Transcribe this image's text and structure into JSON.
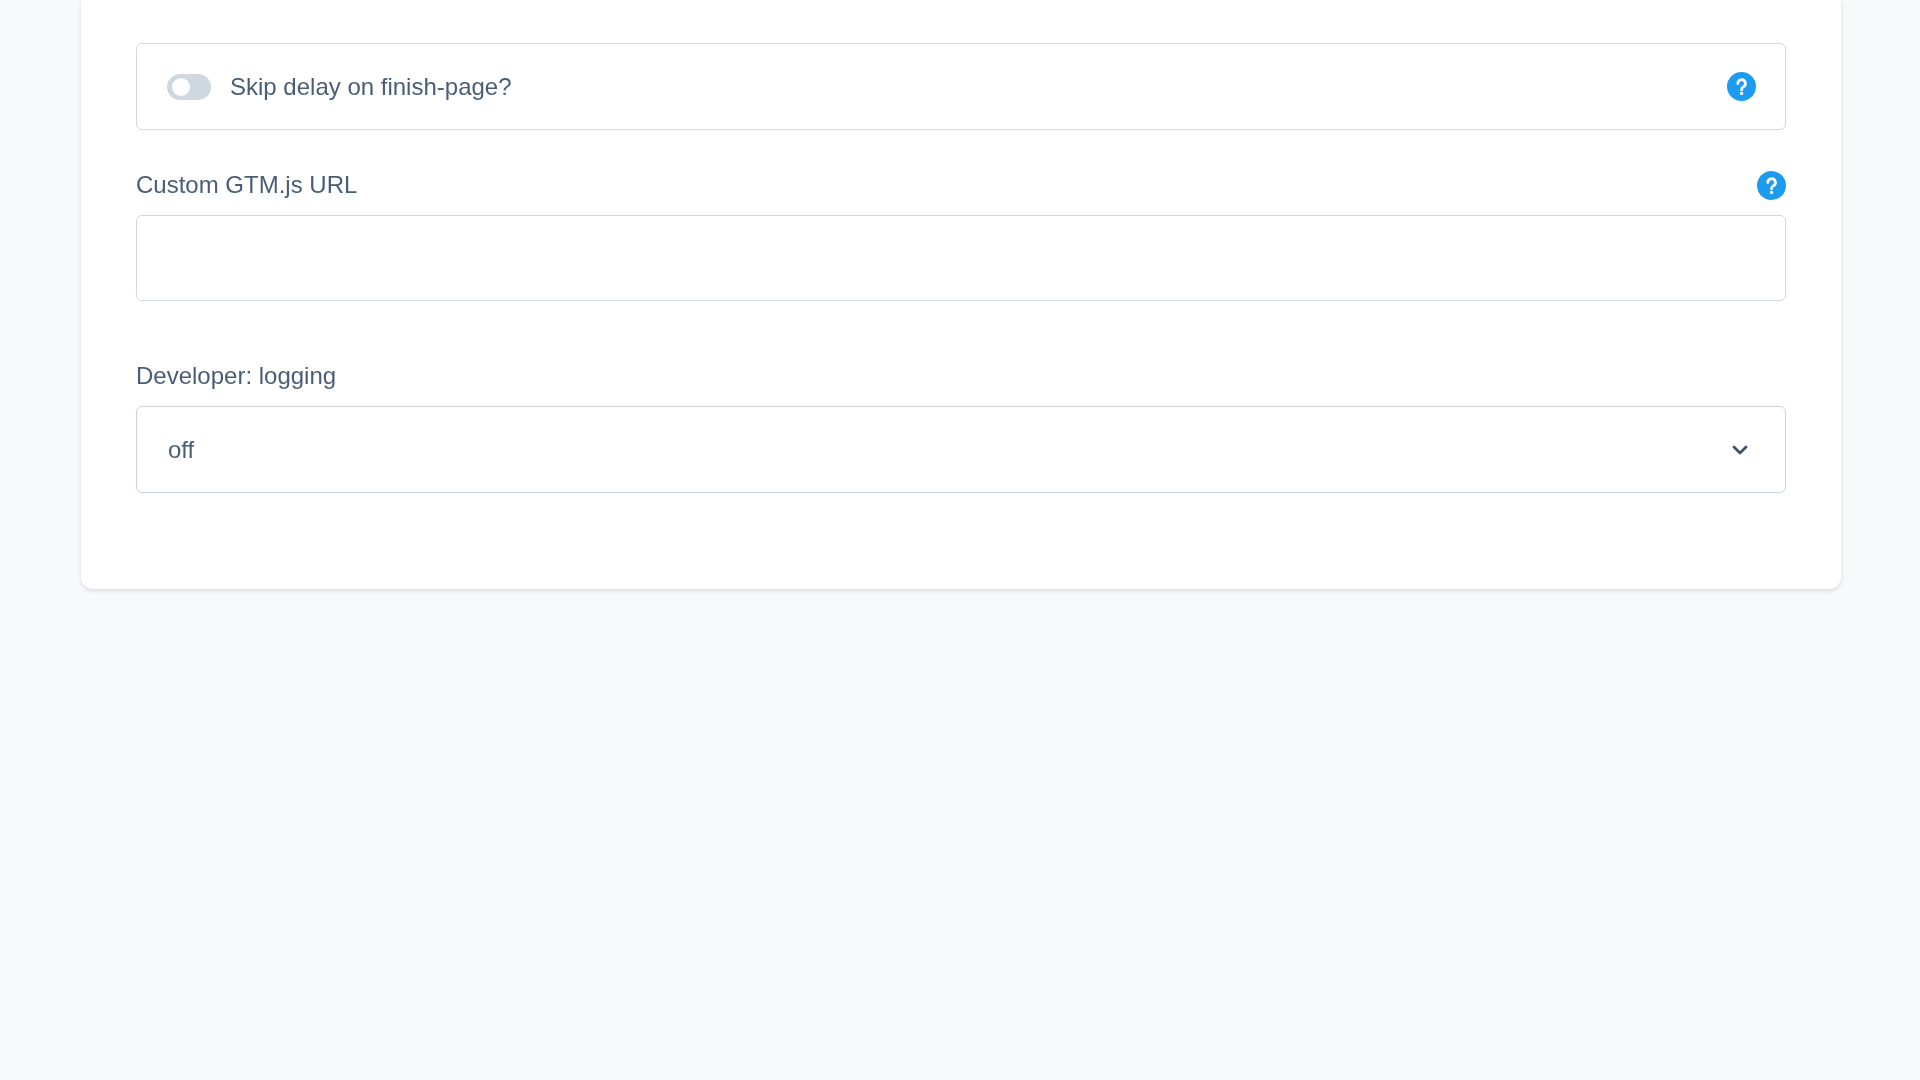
{
  "settings": [
    {
      "kind": "toggle",
      "label": "Skip delay on finish-page?",
      "on": false,
      "help": true
    },
    {
      "kind": "text",
      "label": "Custom GTM.js URL",
      "help": true
    },
    {
      "kind": "select",
      "label": "Developer: logging",
      "value": "off",
      "help": false
    }
  ]
}
